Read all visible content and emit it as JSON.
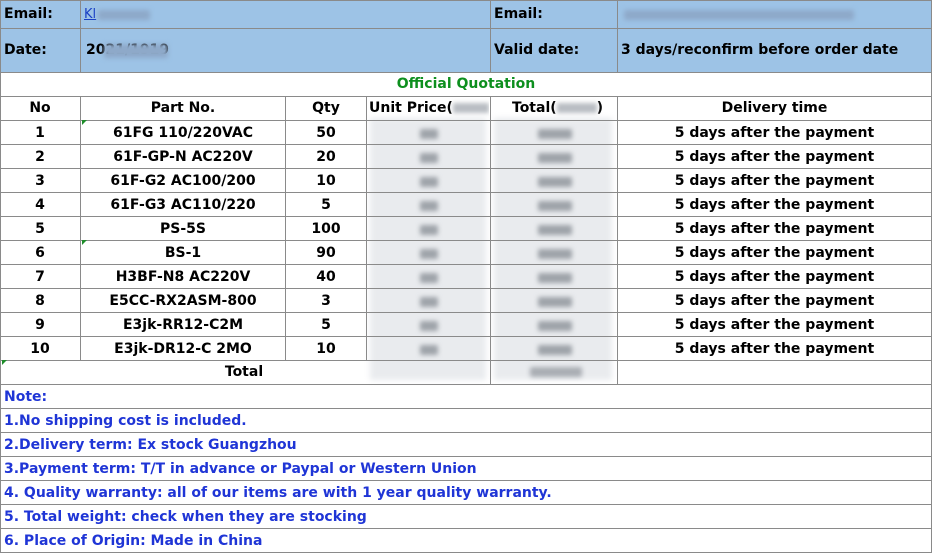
{
  "header": {
    "email_label_1": "Email:",
    "email_value_1": "Kl",
    "email_label_2": "Email:",
    "date_label": "Date:",
    "date_value": "2021/1919",
    "valid_date_label": "Valid date:",
    "valid_date_value": "3 days/reconfirm before order date"
  },
  "title": "Official Quotation",
  "columns": {
    "no": "No",
    "part": "Part No.",
    "qty": "Qty",
    "unit_price": "Unit Price(",
    "total": "Total(",
    "total_suffix": ")",
    "delivery": "Delivery time"
  },
  "rows": [
    {
      "no": "1",
      "part": "61FG  110/220VAC",
      "qty": "50",
      "delivery": "5 days after the payment"
    },
    {
      "no": "2",
      "part": "61F-GP-N  AC220V",
      "qty": "20",
      "delivery": "5 days after the payment"
    },
    {
      "no": "3",
      "part": "61F-G2  AC100/200",
      "qty": "10",
      "delivery": "5 days after the payment"
    },
    {
      "no": "4",
      "part": "61F-G3  AC110/220",
      "qty": "5",
      "delivery": "5 days after the payment"
    },
    {
      "no": "5",
      "part": "PS-5S",
      "qty": "100",
      "delivery": "5 days after the payment"
    },
    {
      "no": "6",
      "part": "BS-1",
      "qty": "90",
      "delivery": "5 days after the payment"
    },
    {
      "no": "7",
      "part": "H3BF-N8  AC220V",
      "qty": "40",
      "delivery": "5 days after the payment"
    },
    {
      "no": "8",
      "part": "E5CC-RX2ASM-800",
      "qty": "3",
      "delivery": "5 days after the payment"
    },
    {
      "no": "9",
      "part": "E3jk-RR12-C2M",
      "qty": "5",
      "delivery": "5 days after the payment"
    },
    {
      "no": "10",
      "part": "E3jk-DR12-C 2MO",
      "qty": "10",
      "delivery": "5 days after the payment"
    }
  ],
  "total_label": "Total",
  "notes": [
    "Note:",
    "1.No shipping cost is included.",
    "2.Delivery term: Ex stock Guangzhou",
    "3.Payment term: T/T in advance or Paypal or Western Union",
    "4. Quality warranty: all of our items are with 1 year quality warranty.",
    "5. Total weight:  check when they are stocking",
    "6. Place of Origin: Made in China"
  ]
}
